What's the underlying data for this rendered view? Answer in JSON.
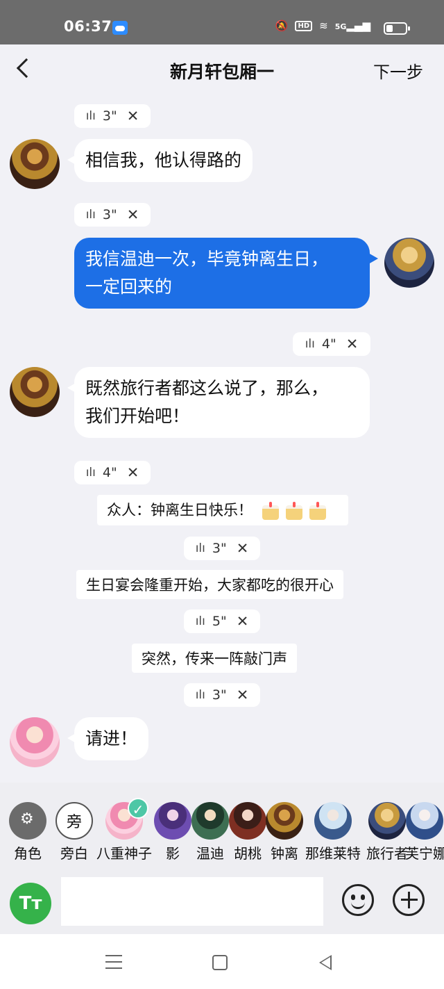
{
  "status": {
    "time": "06:37",
    "hd": "HD",
    "network": "5G"
  },
  "header": {
    "title": "新月轩包厢一",
    "next_label": "下一步"
  },
  "messages": [
    {
      "type": "audio",
      "duration": "3\""
    },
    {
      "type": "text",
      "side": "left",
      "text": "相信我，他认得路的"
    },
    {
      "type": "audio",
      "duration": "3\""
    },
    {
      "type": "text",
      "side": "right",
      "line1": "我信温迪一次，毕竟钟离生日，",
      "line2": "一定回来的"
    },
    {
      "type": "audio",
      "duration": "4\""
    },
    {
      "type": "text",
      "side": "left",
      "line1": "既然旅行者都这么说了，那么，",
      "line2": "我们开始吧！"
    },
    {
      "type": "audio",
      "duration": "4\""
    },
    {
      "type": "narration",
      "text": "众人：钟离生日快乐！"
    },
    {
      "type": "audio",
      "duration": "3\""
    },
    {
      "type": "narration",
      "text": "生日宴会隆重开始，大家都吃的很开心"
    },
    {
      "type": "audio",
      "duration": "5\""
    },
    {
      "type": "narration",
      "text": "突然，传来一阵敲门声"
    },
    {
      "type": "audio",
      "duration": "3\""
    },
    {
      "type": "text",
      "side": "left",
      "text": "请进！"
    }
  ],
  "characters": [
    {
      "name": "角色"
    },
    {
      "name": "旁白",
      "icon_text": "旁"
    },
    {
      "name": "八重神子",
      "selected": true
    },
    {
      "name": "影"
    },
    {
      "name": "温迪"
    },
    {
      "name": "胡桃"
    },
    {
      "name": "钟离"
    },
    {
      "name": "那维莱特"
    },
    {
      "name": "旅行者"
    },
    {
      "name": "芙宁娜"
    }
  ],
  "input": {
    "tt_label": "Tт",
    "placeholder": ""
  },
  "icons": [
    "back-icon",
    "weather-icon",
    "mute-icon",
    "wifi-icon",
    "signal-icon",
    "battery-icon",
    "audio-wave-icon",
    "close-icon",
    "cake-icon",
    "role-settings-icon",
    "check-icon",
    "emoji-icon",
    "plus-icon",
    "menu-icon",
    "home-icon",
    "back-triangle-icon"
  ],
  "colors": {
    "accent_blue": "#1d6fe6",
    "status_bar": "#6c6c6c",
    "tt_green": "#35b24a",
    "check_teal": "#4ec7a6"
  }
}
